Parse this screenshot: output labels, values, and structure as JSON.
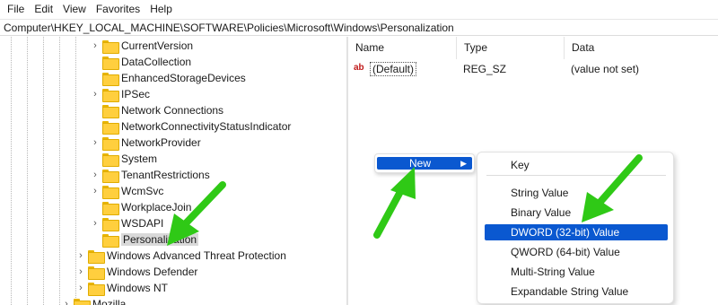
{
  "menubar": {
    "items": [
      "File",
      "Edit",
      "View",
      "Favorites",
      "Help"
    ]
  },
  "address": {
    "path": "Computer\\HKEY_LOCAL_MACHINE\\SOFTWARE\\Policies\\Microsoft\\Windows\\Personalization"
  },
  "tree": {
    "items": [
      {
        "label": "CurrentVersion",
        "expandable": true
      },
      {
        "label": "DataCollection",
        "expandable": false
      },
      {
        "label": "EnhancedStorageDevices",
        "expandable": false
      },
      {
        "label": "IPSec",
        "expandable": true
      },
      {
        "label": "Network Connections",
        "expandable": false
      },
      {
        "label": "NetworkConnectivityStatusIndicator",
        "expandable": false
      },
      {
        "label": "NetworkProvider",
        "expandable": true
      },
      {
        "label": "System",
        "expandable": false
      },
      {
        "label": "TenantRestrictions",
        "expandable": true
      },
      {
        "label": "WcmSvc",
        "expandable": true
      },
      {
        "label": "WorkplaceJoin",
        "expandable": false
      },
      {
        "label": "WSDAPI",
        "expandable": true
      },
      {
        "label": "Personalization",
        "expandable": false,
        "selected": true
      },
      {
        "label": "Windows Advanced Threat Protection",
        "expandable": true
      },
      {
        "label": "Windows Defender",
        "expandable": true
      },
      {
        "label": "Windows NT",
        "expandable": true
      },
      {
        "label": "Mozilla",
        "expandable": true
      }
    ]
  },
  "values": {
    "columns": {
      "name": "Name",
      "type": "Type",
      "data": "Data"
    },
    "rows": [
      {
        "name": "(Default)",
        "type": "REG_SZ",
        "data": "(value not set)",
        "icon": "string-value-icon"
      }
    ]
  },
  "context_menu": {
    "new_label": "New",
    "submenu": [
      "Key",
      "String Value",
      "Binary Value",
      "DWORD (32-bit) Value",
      "QWORD (64-bit) Value",
      "Multi-String Value",
      "Expandable String Value"
    ],
    "highlighted": "DWORD (32-bit) Value"
  },
  "colors": {
    "accent": "#0a58d0",
    "annotation_arrow": "#3ad41a",
    "folder": "#ffcf3e"
  },
  "icons": [
    "folder-icon",
    "chevron-right-icon",
    "string-value-icon",
    "submenu-arrow-icon",
    "green-pointer-arrow"
  ]
}
